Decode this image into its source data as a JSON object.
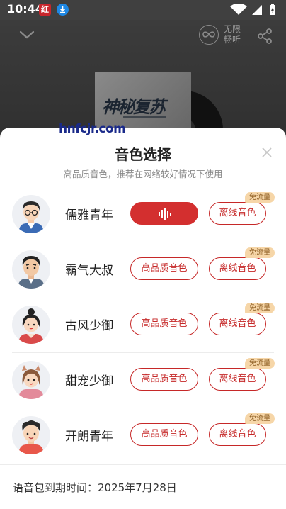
{
  "status_bar": {
    "time": "10:44",
    "app_icon_1": "红",
    "app_icon_2_name": "download-icon"
  },
  "player": {
    "unlimited_line1": "无限",
    "unlimited_line2": "畅听",
    "cover_title": "神秘复苏"
  },
  "sheet": {
    "title": "音色选择",
    "subtitle": "高品质音色，推荐在网络较好情况下使用",
    "hq_label": "高品质音色",
    "offline_label": "离线音色",
    "free_badge": "免流量",
    "expiry": "语音包到期时间：2025年7月28日",
    "voices": [
      {
        "name": "儒雅青年",
        "playing": true
      },
      {
        "name": "霸气大叔",
        "playing": false
      },
      {
        "name": "古风少御",
        "playing": false
      },
      {
        "name": "甜宠少御",
        "playing": false
      },
      {
        "name": "开朗青年",
        "playing": false
      }
    ]
  },
  "watermark": "hnfcjr.com",
  "colors": {
    "accent": "#d32f2f",
    "badge_bg": "#f6d6a8",
    "badge_text": "#8a5a1e"
  }
}
